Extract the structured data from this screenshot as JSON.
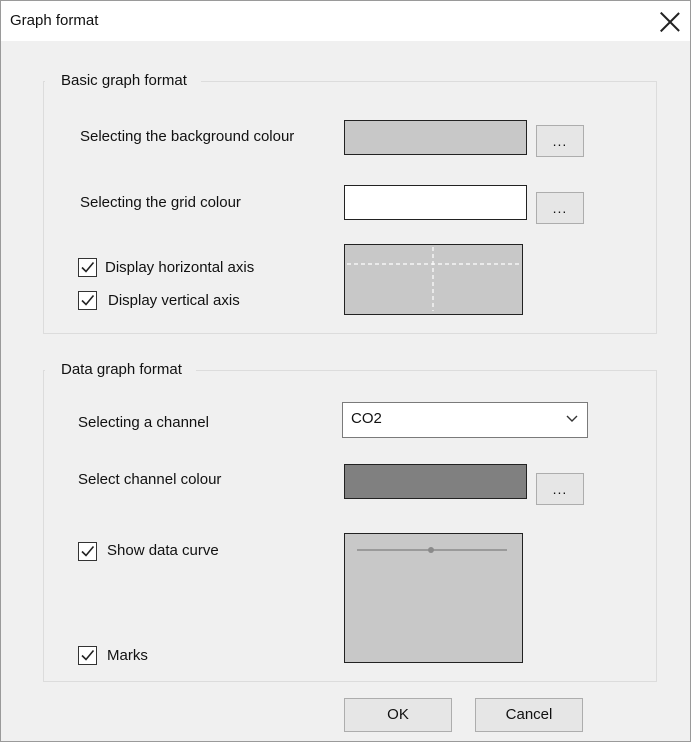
{
  "window": {
    "title": "Graph format"
  },
  "basic": {
    "legend": "Basic graph format",
    "background_label": "Selecting the background colour",
    "background_color": "#c8c8c8",
    "grid_label": "Selecting the grid colour",
    "grid_color": "#ffffff",
    "browse_label": "...",
    "horizontal_axis_label": "Display horizontal axis",
    "horizontal_axis_checked": true,
    "vertical_axis_label": "Display vertical axis",
    "vertical_axis_checked": true
  },
  "data": {
    "legend": "Data graph format",
    "channel_label": "Selecting a channel",
    "channel_value": "CO2",
    "channel_color_label": "Select channel colour",
    "channel_color": "#808080",
    "browse_label": "...",
    "show_curve_label": "Show data curve",
    "show_curve_checked": true,
    "marks_label": "Marks",
    "marks_checked": true
  },
  "buttons": {
    "ok": "OK",
    "cancel": "Cancel"
  }
}
